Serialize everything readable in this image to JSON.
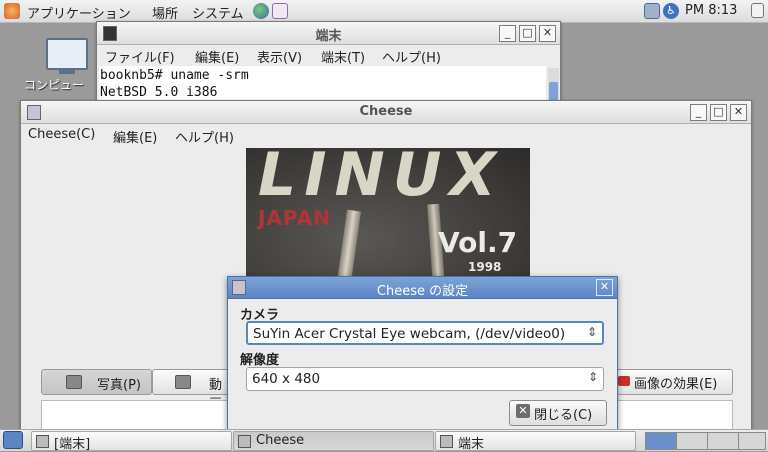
{
  "top_panel": {
    "menus": [
      "アプリケーション",
      "場所",
      "システム"
    ],
    "clock": "PM 8:13"
  },
  "desktop": {
    "icon_label": "コンピュー"
  },
  "terminal": {
    "title": "端末",
    "menus": [
      "ファイル(F)",
      "編集(E)",
      "表示(V)",
      "端末(T)",
      "ヘルプ(H)"
    ],
    "lines": [
      "booknb5# uname -srm",
      "NetBSD 5.0 i386"
    ]
  },
  "cheese": {
    "title": "Cheese",
    "menus": [
      "Cheese(C)",
      "編集(E)",
      "ヘルプ(H)"
    ],
    "webcam_text": {
      "brand": "LINUX",
      "subtitle": "JAPAN",
      "volume": "Vol.7",
      "year": "1998"
    },
    "photo_button": "写真(P)",
    "video_button": "動画",
    "effects_button": "画像の効果(E)"
  },
  "settings_dialog": {
    "title": "Cheese の設定",
    "camera_label": "カメラ",
    "camera_value": "SuYin Acer Crystal Eye webcam, (/dev/video0)",
    "resolution_label": "解像度",
    "resolution_value": "640 x 480",
    "close_button": "閉じる(C)"
  },
  "taskbar": {
    "tasks": [
      "[端末]",
      "Cheese",
      "端末"
    ]
  }
}
